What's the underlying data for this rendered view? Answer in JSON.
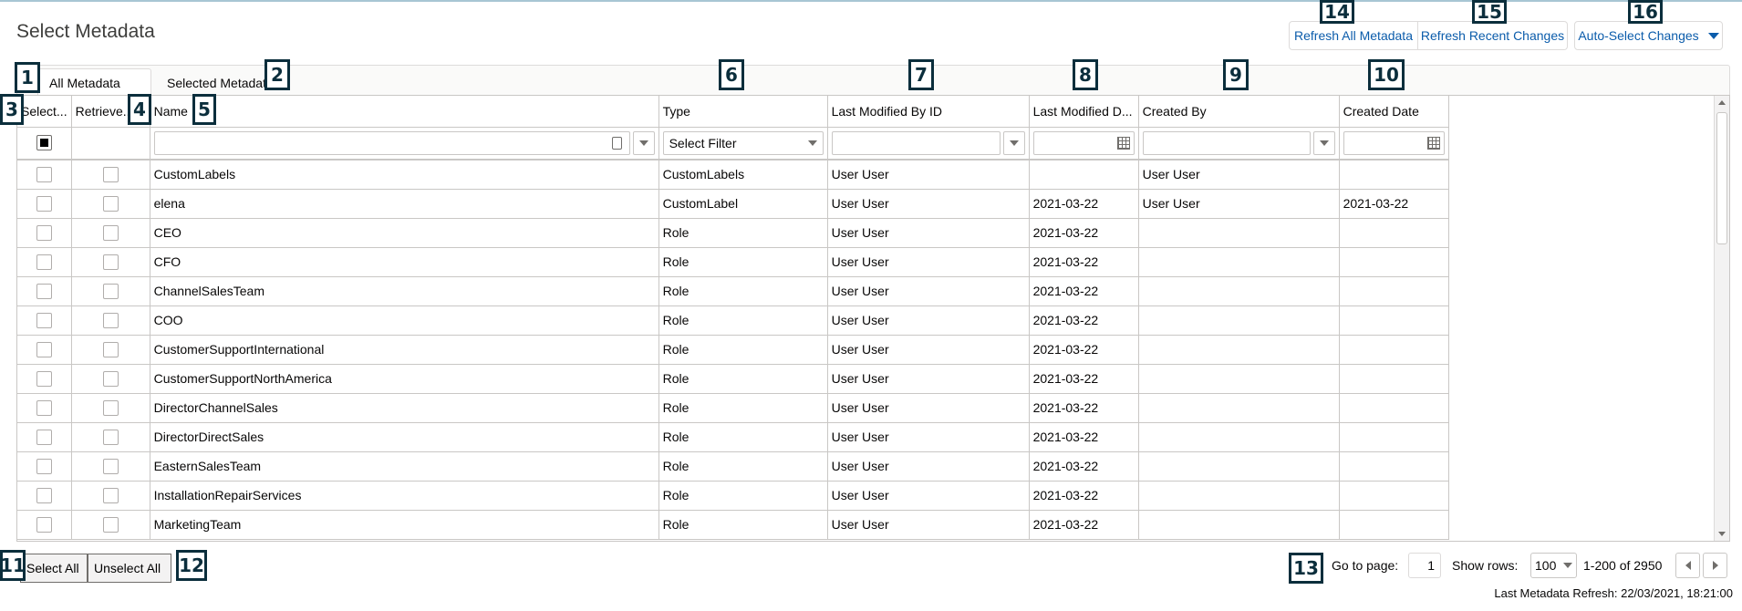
{
  "page": {
    "title": "Select Metadata"
  },
  "toolbar": {
    "refresh_all": "Refresh All Metadata",
    "refresh_recent": "Refresh Recent Changes",
    "auto_select": "Auto-Select Changes"
  },
  "tabs": [
    {
      "label": "All Metadata",
      "active": true
    },
    {
      "label": "Selected Metadata",
      "active": false
    }
  ],
  "columns": [
    "Select...",
    "Retrieve...",
    "Name",
    "Type",
    "Last Modified By ID",
    "Last Modified D...",
    "Created By",
    "Created Date"
  ],
  "filters": {
    "type_placeholder": "Select Filter"
  },
  "rows": [
    {
      "name": "CustomLabels",
      "type": "CustomLabels",
      "modified_by": "User User",
      "modified_date": "",
      "created_by": "User User",
      "created_date": ""
    },
    {
      "name": "elena",
      "type": "CustomLabel",
      "modified_by": "User User",
      "modified_date": "2021-03-22",
      "created_by": "User User",
      "created_date": "2021-03-22"
    },
    {
      "name": "CEO",
      "type": "Role",
      "modified_by": "User User",
      "modified_date": "2021-03-22",
      "created_by": "",
      "created_date": ""
    },
    {
      "name": "CFO",
      "type": "Role",
      "modified_by": "User User",
      "modified_date": "2021-03-22",
      "created_by": "",
      "created_date": ""
    },
    {
      "name": "ChannelSalesTeam",
      "type": "Role",
      "modified_by": "User User",
      "modified_date": "2021-03-22",
      "created_by": "",
      "created_date": ""
    },
    {
      "name": "COO",
      "type": "Role",
      "modified_by": "User User",
      "modified_date": "2021-03-22",
      "created_by": "",
      "created_date": ""
    },
    {
      "name": "CustomerSupportInternational",
      "type": "Role",
      "modified_by": "User User",
      "modified_date": "2021-03-22",
      "created_by": "",
      "created_date": ""
    },
    {
      "name": "CustomerSupportNorthAmerica",
      "type": "Role",
      "modified_by": "User User",
      "modified_date": "2021-03-22",
      "created_by": "",
      "created_date": ""
    },
    {
      "name": "DirectorChannelSales",
      "type": "Role",
      "modified_by": "User User",
      "modified_date": "2021-03-22",
      "created_by": "",
      "created_date": ""
    },
    {
      "name": "DirectorDirectSales",
      "type": "Role",
      "modified_by": "User User",
      "modified_date": "2021-03-22",
      "created_by": "",
      "created_date": ""
    },
    {
      "name": "EasternSalesTeam",
      "type": "Role",
      "modified_by": "User User",
      "modified_date": "2021-03-22",
      "created_by": "",
      "created_date": ""
    },
    {
      "name": "InstallationRepairServices",
      "type": "Role",
      "modified_by": "User User",
      "modified_date": "2021-03-22",
      "created_by": "",
      "created_date": ""
    },
    {
      "name": "MarketingTeam",
      "type": "Role",
      "modified_by": "User User",
      "modified_date": "2021-03-22",
      "created_by": "",
      "created_date": ""
    }
  ],
  "footer": {
    "select_all": "Select All",
    "unselect_all": "Unselect All",
    "go_to_page_label": "Go to page:",
    "page_value": "1",
    "show_rows_label": "Show rows:",
    "rows_value": "100",
    "range": "1-200 of 2950",
    "last_refresh": "Last Metadata Refresh: 22/03/2021, 18:21:00"
  },
  "markers": [
    "1",
    "2",
    "3",
    "4",
    "5",
    "6",
    "7",
    "8",
    "9",
    "10",
    "11",
    "12",
    "13",
    "14",
    "15",
    "16"
  ]
}
